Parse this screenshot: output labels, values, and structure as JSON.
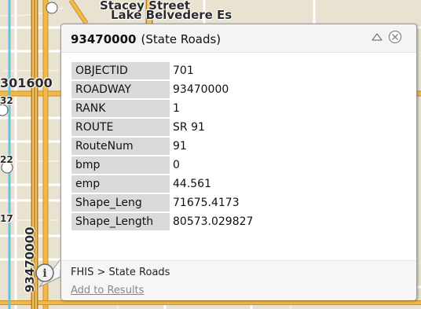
{
  "map": {
    "labels": {
      "street_line1": "Stacey Street",
      "street_line2": "Lake Belvedere Es",
      "route_top": "301600",
      "route_vertical": "93470000",
      "side_a": "32",
      "side_b": "22",
      "side_c": "17"
    },
    "colors": {
      "background": "#e9e2d0",
      "major_road": "#f0b43c",
      "minor_road": "#ffffff",
      "freeway": "#d9a43a"
    }
  },
  "popup": {
    "title_id": "93470000",
    "title_layer": "(State Roads)",
    "maximize_icon": "triangle-up-icon",
    "close_icon": "circle-x-icon",
    "attributes": [
      {
        "key": "OBJECTID",
        "value": "701"
      },
      {
        "key": "ROADWAY",
        "value": "93470000"
      },
      {
        "key": "RANK",
        "value": "1"
      },
      {
        "key": "ROUTE",
        "value": "SR 91"
      },
      {
        "key": "RouteNum",
        "value": "91"
      },
      {
        "key": "bmp",
        "value": "0"
      },
      {
        "key": "emp",
        "value": "44.561"
      },
      {
        "key": "Shape_Leng",
        "value": "71675.4173"
      },
      {
        "key": "Shape_Length",
        "value": "80573.029827"
      }
    ],
    "breadcrumb": "FHIS > State Roads",
    "add_to_results": "Add to Results"
  },
  "marker": {
    "icon": "info-icon",
    "glyph": "i"
  }
}
